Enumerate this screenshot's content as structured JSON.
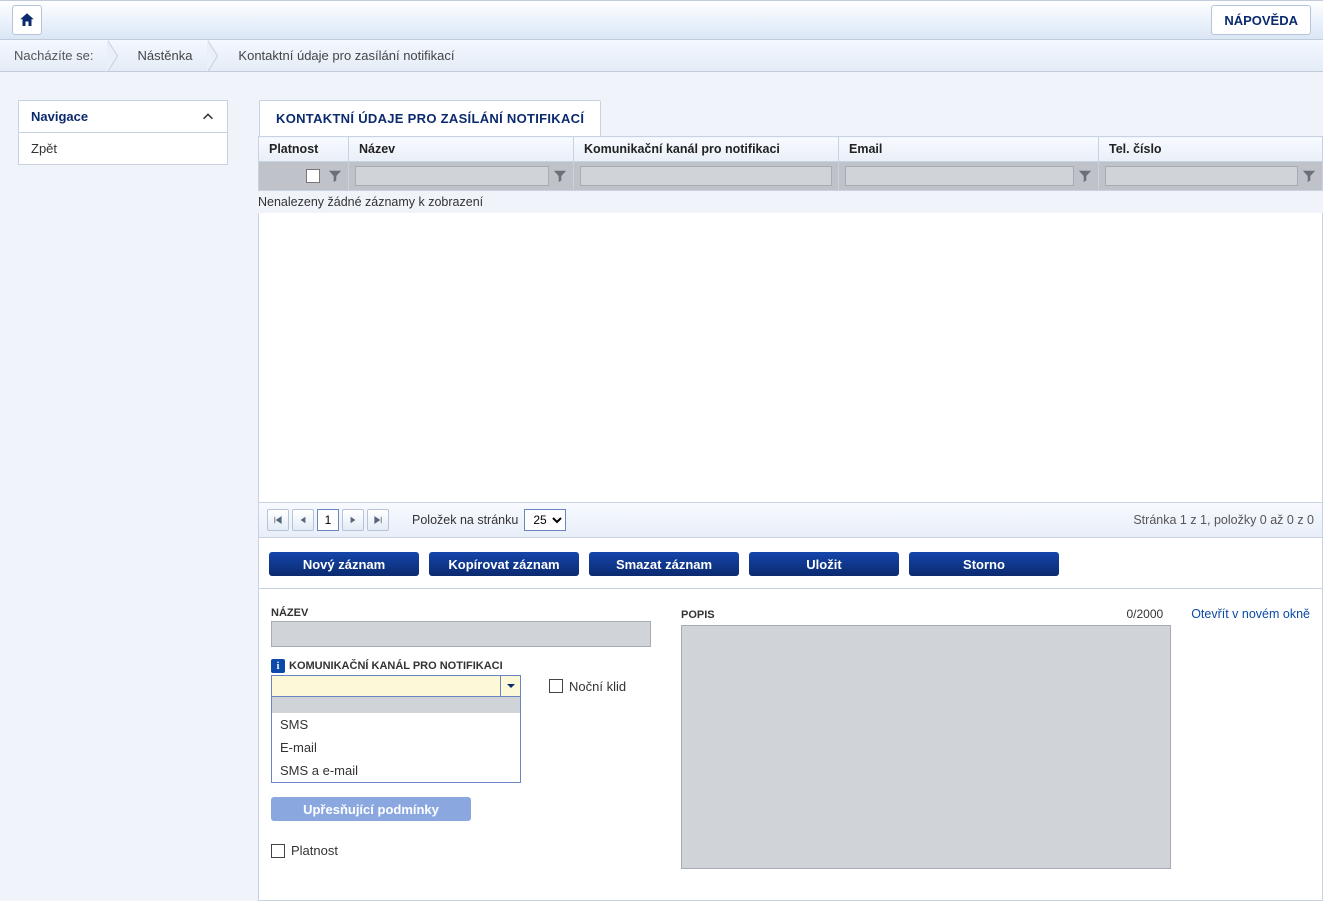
{
  "topbar": {
    "help_label": "NÁPOVĚDA"
  },
  "breadcrumb": {
    "label": "Nacházíte se:",
    "items": [
      "Nástěnka",
      "Kontaktní údaje pro zasílání notifikací"
    ]
  },
  "sidebar": {
    "nav_title": "Navigace",
    "back_label": "Zpět"
  },
  "page": {
    "title": "KONTAKTNÍ ÚDAJE PRO ZASÍLÁNÍ NOTIFIKACÍ"
  },
  "table": {
    "columns": [
      "Platnost",
      "Název",
      "Komunikační kanál pro notifikaci",
      "Email",
      "Tel. číslo"
    ],
    "no_records": "Nenalezeny žádné záznamy k zobrazení"
  },
  "pager": {
    "page": "1",
    "page_size_label": "Položek na stránku",
    "page_size": "25",
    "info": "Stránka 1 z 1, položky 0 až 0 z 0"
  },
  "actions": {
    "new": "Nový záznam",
    "copy": "Kopírovat záznam",
    "delete": "Smazat záznam",
    "save": "Uložit",
    "cancel": "Storno"
  },
  "form": {
    "nazev_label": "NÁZEV",
    "kanal_label": "KOMUNIKAČNÍ KANÁL PRO NOTIFIKACI",
    "nocni_klid_label": "Noční klid",
    "dropdown_options": [
      "SMS",
      "E-mail",
      "SMS a e-mail"
    ],
    "upresnujici_label": "Upřesňující podmínky",
    "platnost_label": "Platnost",
    "popis_label": "POPIS",
    "char_count": "0/2000",
    "open_new": "Otevřít v novém okně"
  }
}
